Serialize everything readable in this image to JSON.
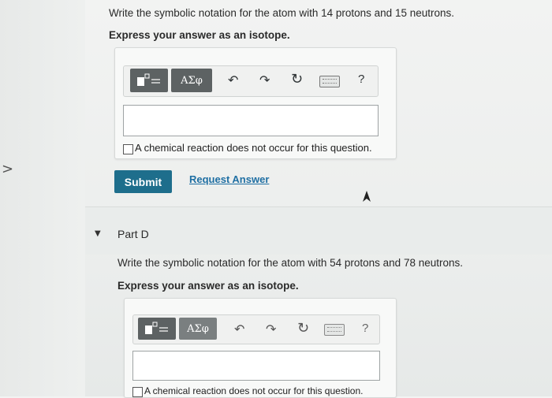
{
  "question_c": {
    "prompt": "Write the symbolic notation for the atom with 14 protons and 15 neutrons.",
    "instruction": "Express your answer as an isotope.",
    "toolbar": {
      "template_icon": "template-icon",
      "greek_label": "ΑΣφ",
      "undo_icon": "undo-icon",
      "redo_icon": "redo-icon",
      "reset_icon": "reset-icon",
      "keyboard_icon": "keyboard-icon",
      "help_label": "?"
    },
    "answer_value": "",
    "no_reaction_label": "A chemical reaction does not occur for this question.",
    "submit_label": "Submit",
    "request_answer_label": "Request Answer"
  },
  "part_d": {
    "title": "Part D",
    "prompt": "Write the symbolic notation for the atom with 54 protons and 78 neutrons.",
    "instruction": "Express your answer as an isotope.",
    "toolbar": {
      "greek_label": "ΑΣφ",
      "help_label": "?"
    },
    "answer_value": "",
    "no_reaction_label": "A chemical reaction does not occur for this question."
  },
  "nav": {
    "chevron": ">"
  }
}
